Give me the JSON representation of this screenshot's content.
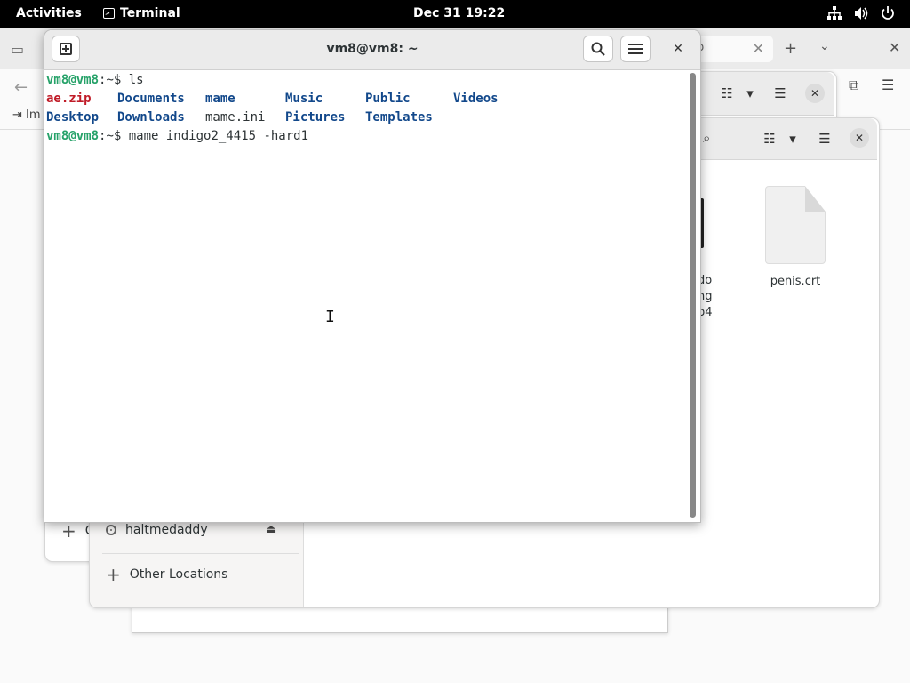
{
  "topbar": {
    "activities": "Activities",
    "app": "Terminal",
    "clock": "Dec 31  19:22",
    "tray": [
      "network-icon",
      "volume-icon",
      "power-icon"
    ]
  },
  "terminal": {
    "title": "vm8@vm8: ~",
    "lines": [
      {
        "prompt": "vm8@vm8",
        "path": ":~$ ",
        "cmd": "ls"
      },
      {
        "prompt": "vm8@vm8",
        "path": ":~$ ",
        "cmd": "mame indigo2_4415 -hard1"
      }
    ],
    "ls_output": [
      [
        {
          "text": "ae.zip",
          "kind": "zip",
          "col": 0
        },
        {
          "text": "Documents",
          "kind": "dir",
          "col": 1
        },
        {
          "text": "mame",
          "kind": "dir",
          "col": 2
        },
        {
          "text": "Music",
          "kind": "dir",
          "col": 3
        },
        {
          "text": "Public",
          "kind": "dir",
          "col": 4
        },
        {
          "text": "Videos",
          "kind": "dir",
          "col": 5
        }
      ],
      [
        {
          "text": "Desktop",
          "kind": "dir",
          "col": 0
        },
        {
          "text": "Downloads",
          "kind": "dir",
          "col": 1
        },
        {
          "text": "mame.ini",
          "kind": "file",
          "col": 2
        },
        {
          "text": "Pictures",
          "kind": "dir",
          "col": 3
        },
        {
          "text": "Templates",
          "kind": "dir",
          "col": 4
        }
      ]
    ]
  },
  "files_window": {
    "sidebar": {
      "drive": "haltmedaddy",
      "other_locations": "Other Locations",
      "partial_label": "C"
    },
    "files": [
      {
        "name": "penis.crt"
      }
    ],
    "partial_file_text": [
      "do",
      "ng",
      "p4"
    ]
  },
  "browser": {
    "tab_partial": "b",
    "import_partial": "Im"
  },
  "colors": {
    "prompt": "#26a269",
    "directory": "#12488b",
    "archive": "#c01c28",
    "topbar": "#000000"
  }
}
